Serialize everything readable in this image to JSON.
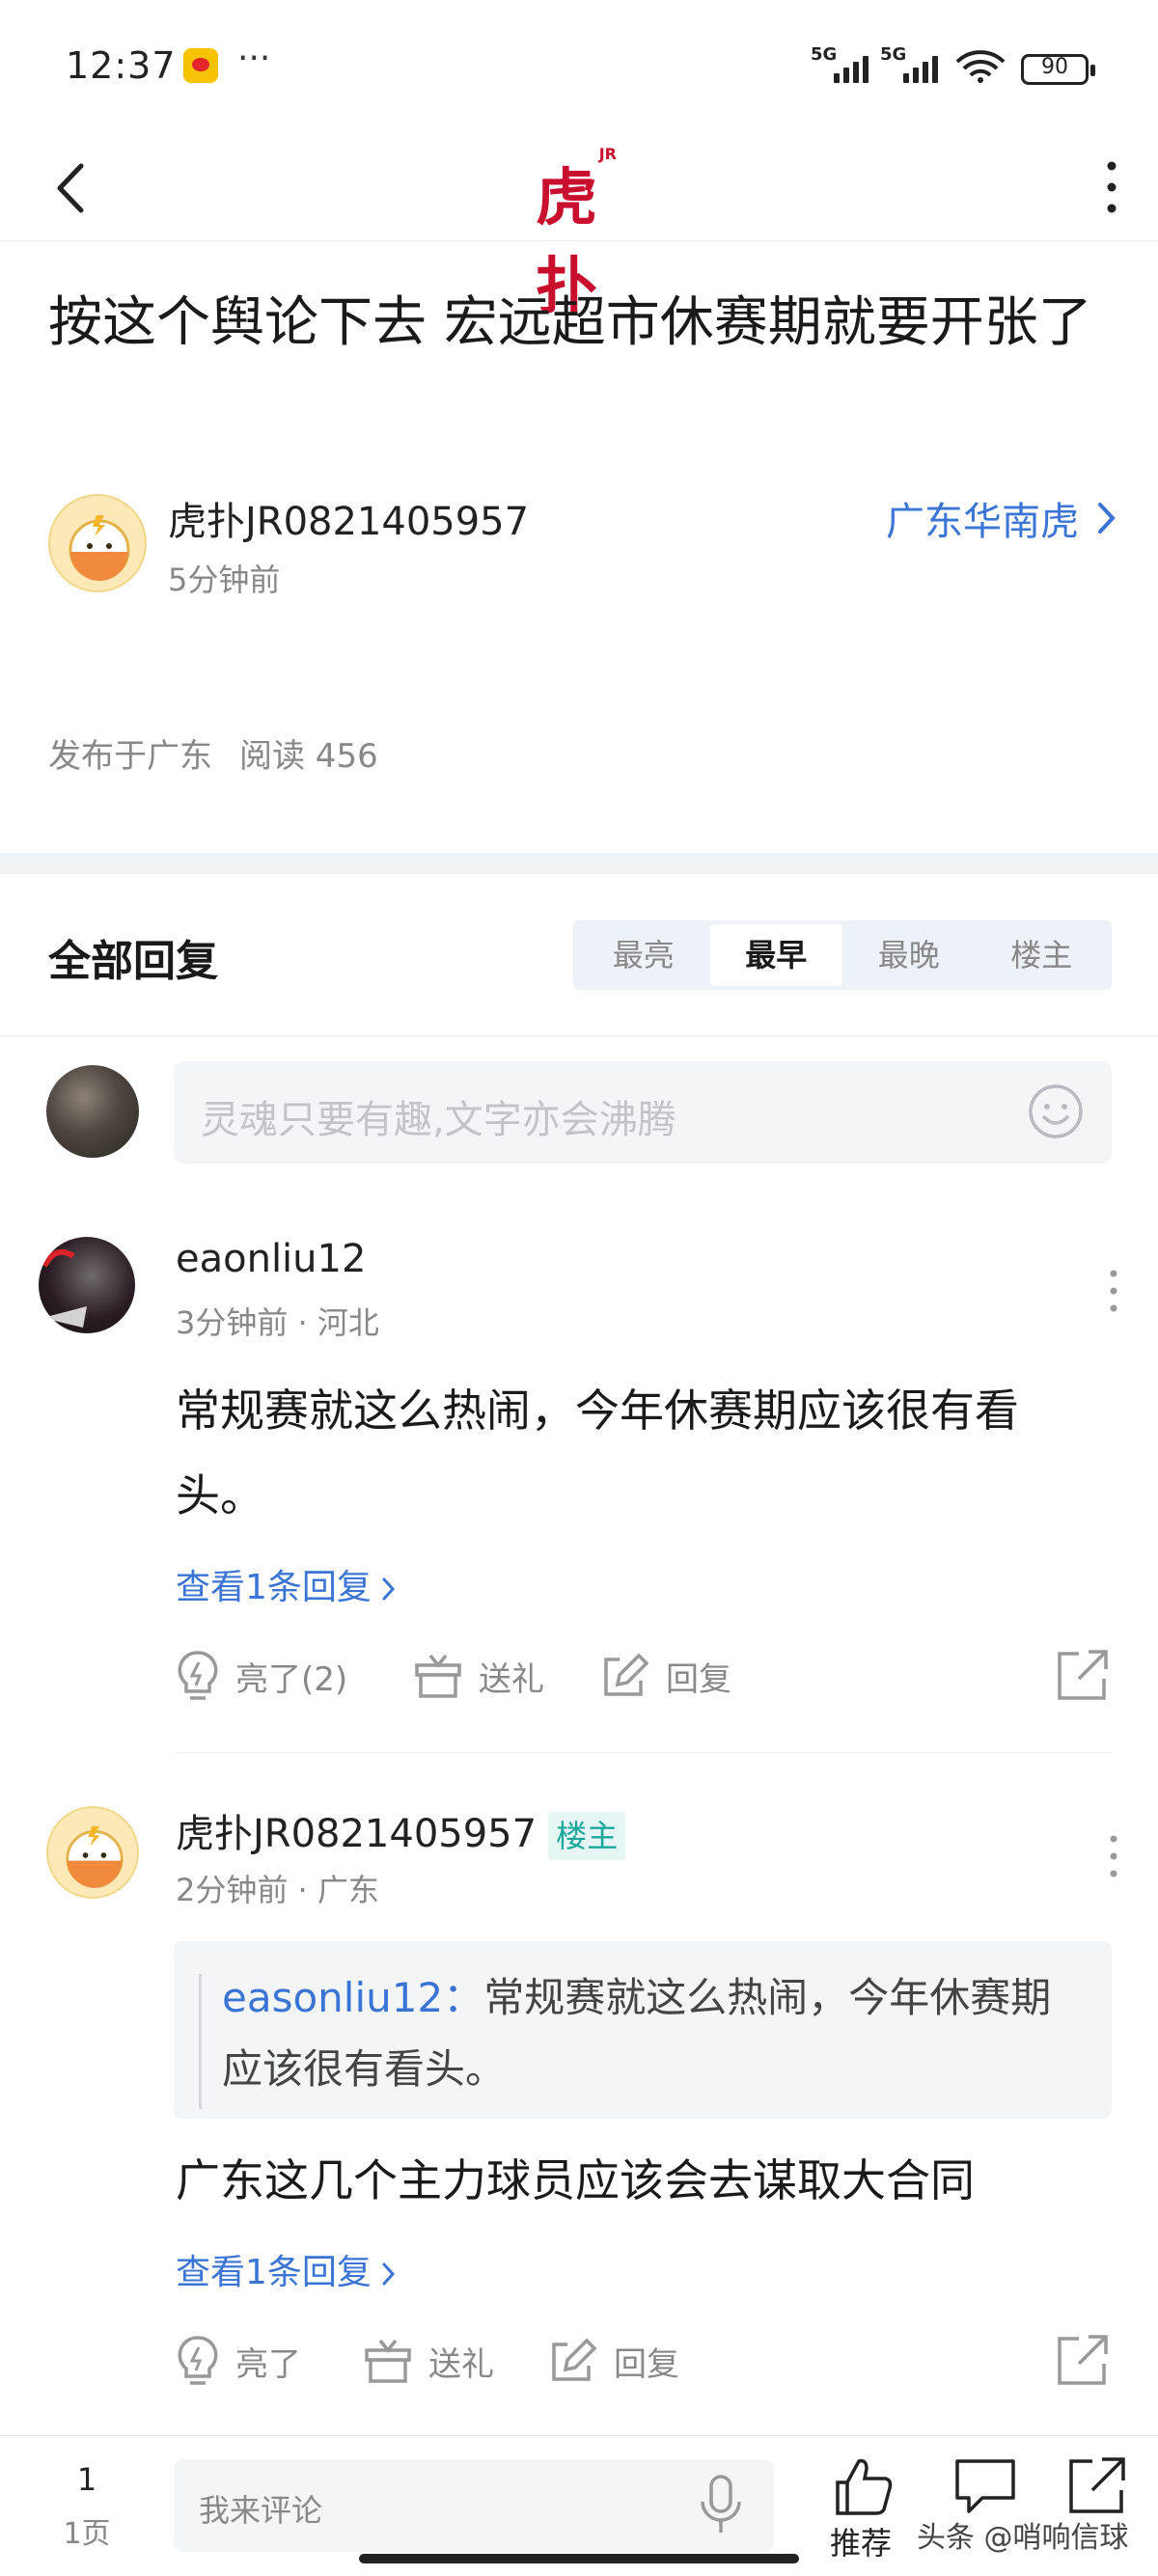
{
  "status_bar": {
    "time": "12:37",
    "signal1_tag": "5G",
    "signal2_tag": "5G",
    "battery": "90"
  },
  "nav": {
    "logo_text": "虎扑",
    "logo_sub": "JR"
  },
  "post": {
    "title": "按这个舆论下去 宏远超市休赛期就要开张了",
    "author": "虎扑JR0821405957",
    "time": "5分钟前",
    "board": "广东华南虎",
    "location": "发布于广东",
    "reads": "阅读 456"
  },
  "replies": {
    "title": "全部回复",
    "tabs": [
      "最亮",
      "最早",
      "最晚",
      "楼主"
    ],
    "active_tab": "最早",
    "input_placeholder": "灵魂只要有趣,文字亦会沸腾"
  },
  "comments": [
    {
      "user": "eaonliu12",
      "meta": "3分钟前 · 河北",
      "text": "常规赛就这么热闹，今年休赛期应该很有看头。",
      "view_replies": "查看1条回复",
      "like": "亮了(2)",
      "gift": "送礼",
      "reply": "回复"
    },
    {
      "user": "虎扑JR0821405957",
      "badge": "楼主",
      "meta": "2分钟前 · 广东",
      "quote_user": "easonliu12：",
      "quote_text": "常规赛就这么热闹，今年休赛期应该很有看头。",
      "text": "广东这几个主力球员应该会去谋取大合同",
      "view_replies": "查看1条回复",
      "like": "亮了",
      "gift": "送礼",
      "reply": "回复"
    }
  ],
  "bottom_bar": {
    "page_current": "1",
    "page_total": "1页",
    "placeholder": "我来评论",
    "recommend": "推荐",
    "watermark": "头条 @哨响信球"
  }
}
